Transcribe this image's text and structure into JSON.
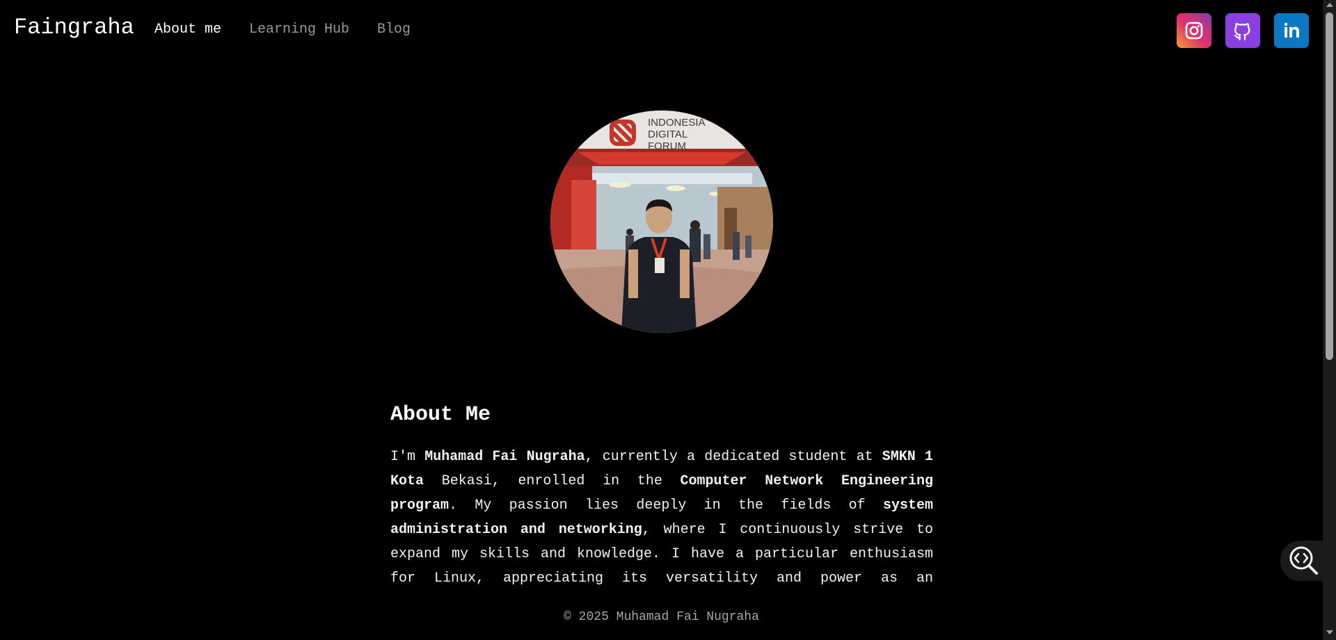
{
  "header": {
    "brand": "Faingraha",
    "nav": [
      {
        "label": "About me",
        "active": true
      },
      {
        "label": "Learning Hub",
        "active": false
      },
      {
        "label": "Blog",
        "active": false
      }
    ],
    "social": [
      {
        "icon": "instagram-icon",
        "color": "#e1306c"
      },
      {
        "icon": "github-icon",
        "color": "#8a3fe0"
      },
      {
        "icon": "linkedin-icon",
        "color": "#0a78c2"
      }
    ]
  },
  "avatar": {
    "sign_line1": "INDONESIA",
    "sign_line2": "DIGITAL",
    "sign_line3": "FORUM"
  },
  "about": {
    "title": "About Me",
    "p_1": "I'm ",
    "b_1": "Muhamad Fai Nugraha",
    "p_2": ", currently a dedicated student at ",
    "b_2": "SMKN 1 Kota",
    "p_3": " Bekasi, enrolled in the ",
    "b_3": "Computer Network Engineering program",
    "p_4": ". My passion lies deeply in the fields of ",
    "b_4": "system administration and networking",
    "p_5": ", where I continuously strive to expand my skills and knowledge. I have a particular enthusiasm for Linux, appreciating its versatility and power as an operating"
  },
  "footer": {
    "text": "© 2025 Muhamad Fai Nugraha"
  },
  "tools": {
    "inspect_icon": "code-search-icon"
  },
  "colors": {
    "background": "#000000",
    "text": "#ffffff",
    "muted": "#9a9a9a"
  }
}
